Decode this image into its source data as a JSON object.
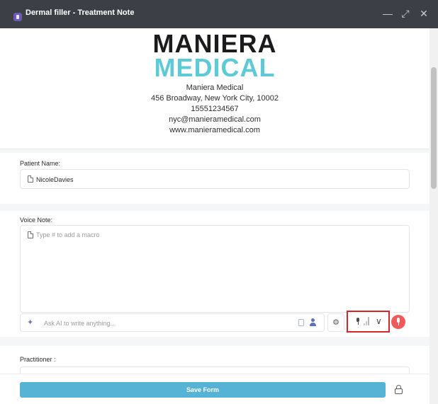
{
  "window": {
    "title": "Dermal filler - Treatment Note",
    "controls": [
      "minimize-icon",
      "maximize-icon",
      "close-icon"
    ]
  },
  "header": {
    "logo_line1": "MANIERA",
    "logo_line2": "MEDICAL",
    "clinic_name": "Maniera Medical",
    "address": "456 Broadway, New York City, 10002",
    "phone": "15551234567",
    "email": "nyc@manieramedical.com",
    "website": "www.manieramedical.com"
  },
  "form": {
    "patient": {
      "label": "Patient Name:",
      "value": "NicoleDavies"
    },
    "voice_note": {
      "label": "Voice Note:",
      "placeholder": "Type # to add a macro",
      "ai_placeholder": "Ask AI to write anything..."
    },
    "practitioner": {
      "label": "Practitioner :"
    }
  },
  "footer": {
    "save_label": "Save Form"
  },
  "icons": {
    "app": "app-icon",
    "field": "document-icon",
    "ai": "sparkle-icon",
    "clipboard": "clipboard-icon",
    "person": "person-icon",
    "settings": "gear-icon",
    "microphone": "microphone-icon",
    "dropdown": "chevron-down-icon",
    "record": "microphone-record-icon",
    "lock": "lock-icon"
  },
  "colors": {
    "titlebar": "#3c3f46",
    "logo_dark": "#1b1b1d",
    "logo_accent": "#5ecad6",
    "save_button": "#56b3d6",
    "record_button": "#f05a5a",
    "highlight_border": "#d5262e"
  }
}
